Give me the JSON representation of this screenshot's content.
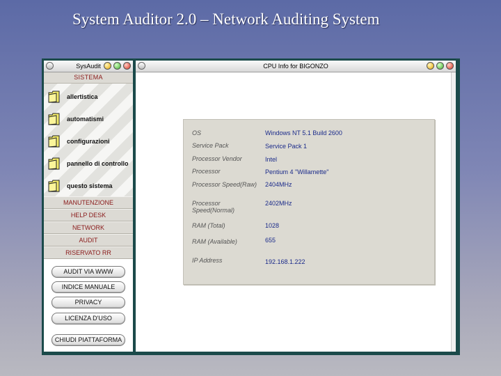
{
  "slide": {
    "title": "System Auditor 2.0 – Network Auditing System"
  },
  "left_window": {
    "title": "SysAudit",
    "section_header": "SISTEMA",
    "folders": [
      {
        "label": "allertistica",
        "icon": "folder-icon"
      },
      {
        "label": "automatismi",
        "icon": "folder-icon"
      },
      {
        "label": "configurazioni",
        "icon": "folder-icon"
      },
      {
        "label": "pannello di controllo",
        "icon": "folder-icon"
      },
      {
        "label": "questo sistema",
        "icon": "folder-icon"
      }
    ],
    "menu": [
      "MANUTENZIONE",
      "HELP DESK",
      "NETWORK",
      "AUDIT",
      "RISERVATO RR"
    ],
    "buttons": [
      "AUDIT VIA WWW",
      "INDICE MANUALE",
      "PRIVACY",
      "LICENZA D'USO"
    ],
    "bottom_button": "CHIUDI PIATTAFORMA"
  },
  "right_window": {
    "title": "CPU Info for BIGONZO",
    "info": [
      {
        "label": "OS",
        "value": "Windows NT 5.1 Build 2600"
      },
      {
        "label": "Service Pack",
        "value": "Service Pack 1"
      },
      {
        "label": "Processor Vendor",
        "value": "Intel"
      },
      {
        "label": "Processor",
        "value": "Pentium 4 \"Willamette\""
      },
      {
        "label": "Processor Speed(Raw)",
        "value": "2404MHz"
      },
      {
        "label": "Processor Speed(Normal)",
        "value": "2402MHz"
      },
      {
        "label": "RAM (Total)",
        "value": "1028"
      },
      {
        "label": "RAM (Available)",
        "value": "655"
      },
      {
        "label": "IP Address",
        "value": "192.168.1.222"
      }
    ]
  },
  "colors": {
    "menu_text": "#8a1a1a",
    "info_value": "#1a2a8a",
    "frame": "#1b4a4a",
    "button_yellow": "#e8a800",
    "button_green": "#3fae2a",
    "button_red": "#d8301c"
  }
}
